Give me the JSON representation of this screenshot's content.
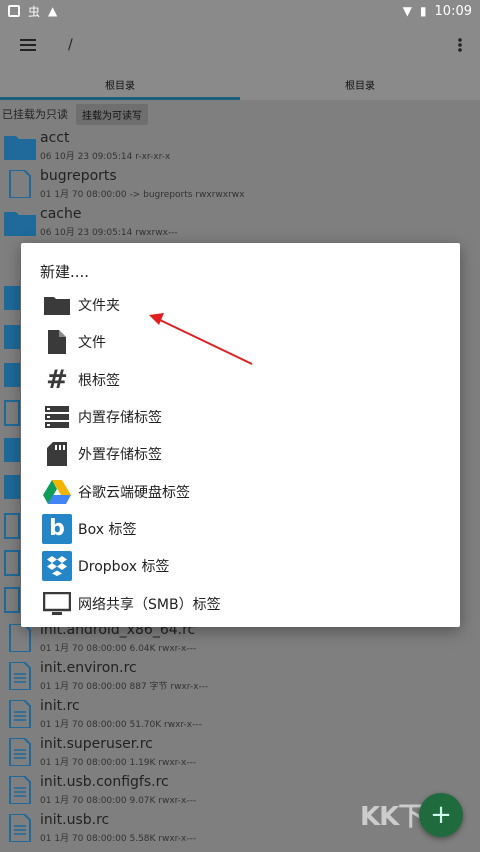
{
  "status_bar": {
    "time": "10:09",
    "app_icon_text": "虫"
  },
  "app_bar": {
    "path": "/"
  },
  "tabs": [
    {
      "label": "根目录",
      "active": true
    },
    {
      "label": "根目录",
      "active": false
    }
  ],
  "mount": {
    "status": "已挂载为只读",
    "button": "挂载为可读写"
  },
  "files": [
    {
      "name": "acct",
      "meta": "06 10月 23 09:05:14   r-xr-xr-x",
      "icon": "folder-icon"
    },
    {
      "name": "bugreports",
      "meta": "01 1月 70 08:00:00  -> bugreports  rwxrwxrwx",
      "icon": "file-icon"
    },
    {
      "name": "cache",
      "meta": "06 10月 23 09:05:14   rwxrwx---",
      "icon": "folder-icon"
    },
    {
      "name": "init.android_x86_64.rc",
      "meta": "01 1月 70 08:00:00   6.04K  rwxr-x---",
      "icon": "file-icon"
    },
    {
      "name": "init.environ.rc",
      "meta": "01 1月 70 08:00:00   887 字节   rwxr-x---",
      "icon": "file-icon"
    },
    {
      "name": "init.rc",
      "meta": "01 1月 70 08:00:00   51.70K  rwxr-x---",
      "icon": "file-icon"
    },
    {
      "name": "init.superuser.rc",
      "meta": "01 1月 70 08:00:00   1.19K  rwxr-x---",
      "icon": "file-icon"
    },
    {
      "name": "init.usb.configfs.rc",
      "meta": "01 1月 70 08:00:00   9.07K  rwxr-x---",
      "icon": "file-icon"
    },
    {
      "name": "init.usb.rc",
      "meta": "01 1月 70 08:00:00   5.58K  rwxr-x---",
      "icon": "file-icon"
    }
  ],
  "dialog": {
    "title": "新建....",
    "options": [
      {
        "label": "文件夹",
        "icon": "folder-icon"
      },
      {
        "label": "文件",
        "icon": "file-icon"
      },
      {
        "label": "根标签",
        "icon": "hash-icon"
      },
      {
        "label": "内置存储标签",
        "icon": "storage-icon"
      },
      {
        "label": "外置存储标签",
        "icon": "sd-card-icon"
      },
      {
        "label": "谷歌云端硬盘标签",
        "icon": "google-drive-icon"
      },
      {
        "label": "Box 标签",
        "icon": "box-icon"
      },
      {
        "label": "Dropbox 标签",
        "icon": "dropbox-icon"
      },
      {
        "label": "网络共享（SMB）标签",
        "icon": "monitor-icon"
      }
    ]
  },
  "fab": {
    "label": "+"
  },
  "watermark": "KK下载",
  "colors": {
    "accent": "#1a5f7a",
    "folder": "#1f6a9a",
    "arrow": "#e02020",
    "fab": "#1f6b3e"
  }
}
